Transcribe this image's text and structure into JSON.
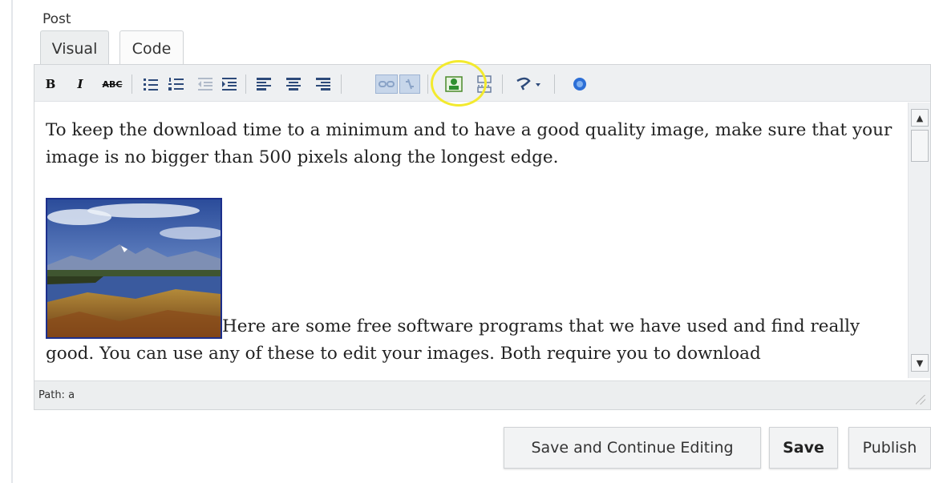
{
  "post_label": "Post",
  "tabs": [
    {
      "label": "Visual",
      "active": true
    },
    {
      "label": "Code",
      "active": false
    }
  ],
  "toolbar": {
    "bold": "B",
    "italic": "I",
    "strike": "ABC",
    "icons": [
      "bold-icon",
      "italic-icon",
      "strikethrough-icon",
      "bullet-list-icon",
      "numbered-list-icon",
      "outdent-icon",
      "indent-icon",
      "align-left-icon",
      "align-center-icon",
      "align-right-icon",
      "insert-link-icon",
      "unlink-icon",
      "insert-image-icon",
      "insert-more-icon",
      "spellcheck-icon",
      "help-icon"
    ],
    "highlight_color": "#f3ea2e"
  },
  "content": {
    "para1": "To keep the download time to a minimum and to have a good quality image, make sure that your image is no bigger than 500 pixels along the longest edge.",
    "para2": "Here are some free software programs that we have used and find really good.  You can use any of these to edit your images.  Both require you to download"
  },
  "path_bar": "Path: a",
  "buttons": {
    "save_continue": "Save and Continue Editing",
    "save": "Save",
    "publish": "Publish"
  }
}
